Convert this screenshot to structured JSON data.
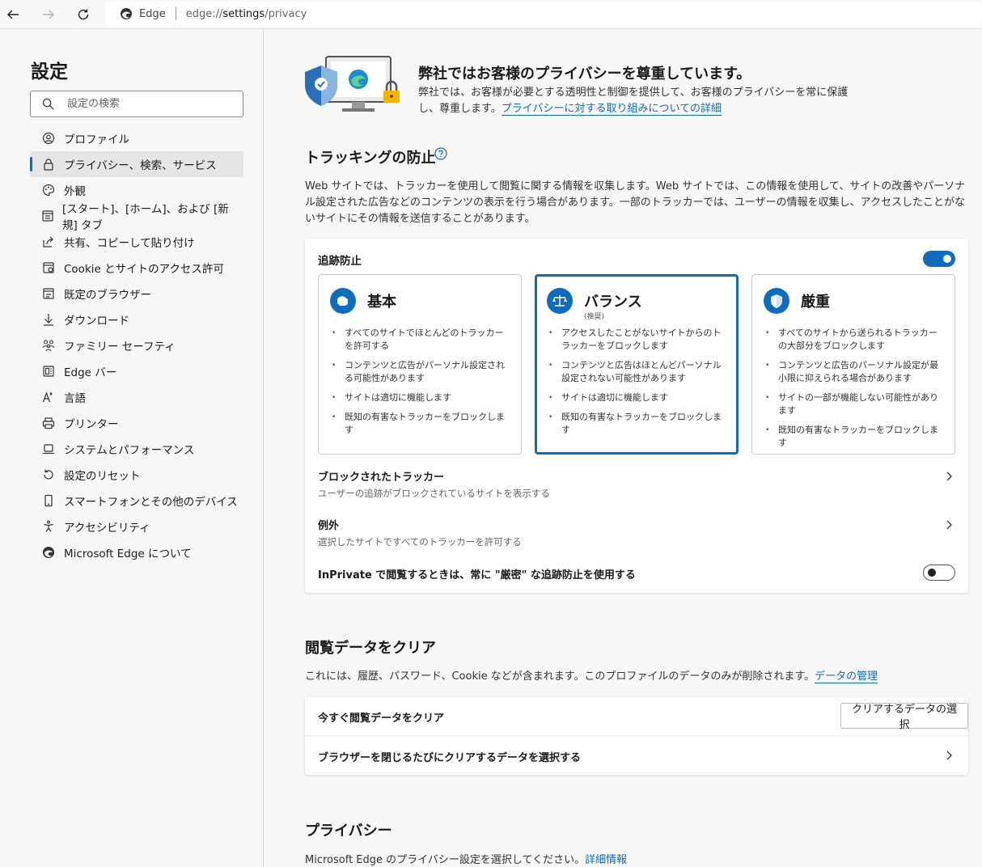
{
  "browser": {
    "brand": "Edge",
    "url_prefix": "edge://",
    "url_host": "settings",
    "url_path": "/privacy"
  },
  "sidebar": {
    "title": "設定",
    "search_placeholder": "設定の検索",
    "items": [
      {
        "label": "プロファイル",
        "icon": "profile-icon"
      },
      {
        "label": "プライバシー、検索、サービス",
        "icon": "lock-icon",
        "active": true
      },
      {
        "label": "外観",
        "icon": "palette-icon"
      },
      {
        "label": "[スタート]、[ホーム]、および [新規] タブ",
        "icon": "home-tabs-icon"
      },
      {
        "label": "共有、コピーして貼り付け",
        "icon": "share-icon"
      },
      {
        "label": "Cookie とサイトのアクセス許可",
        "icon": "cookie-permissions-icon"
      },
      {
        "label": "既定のブラウザー",
        "icon": "default-browser-icon"
      },
      {
        "label": "ダウンロード",
        "icon": "download-icon"
      },
      {
        "label": "ファミリー セーフティ",
        "icon": "family-icon"
      },
      {
        "label": "Edge バー",
        "icon": "edge-bar-icon"
      },
      {
        "label": "言語",
        "icon": "language-icon"
      },
      {
        "label": "プリンター",
        "icon": "printer-icon"
      },
      {
        "label": "システムとパフォーマンス",
        "icon": "laptop-icon"
      },
      {
        "label": "設定のリセット",
        "icon": "reset-icon"
      },
      {
        "label": "スマートフォンとその他のデバイス",
        "icon": "phone-icon"
      },
      {
        "label": "アクセシビリティ",
        "icon": "accessibility-icon"
      },
      {
        "label": "Microsoft Edge について",
        "icon": "edge-logo-icon"
      }
    ]
  },
  "hero": {
    "title": "弊社ではお客様のプライバシーを尊重しています。",
    "desc": "弊社では、お客様が必要とする透明性と制御を提供して、お客様のプライバシーを常に保護し、尊重します。",
    "link": "プライバシーに対する取り組みについての詳細"
  },
  "tracking": {
    "title": "トラッキングの防止",
    "desc": "Web サイトでは、トラッカーを使用して閲覧に関する情報を収集します。Web サイトでは、この情報を使用して、サイトの改善やパーソナル設定された広告などのコンテンツの表示を行う場合があります。一部のトラッカーでは、ユーザーの情報を収集し、アクセスしたことがないサイトにその情報を送信することがあります。",
    "toggle_label": "追跡防止",
    "toggle_on": true,
    "options": [
      {
        "title": "基本",
        "subtitle": "",
        "bullets": [
          "すべてのサイトでほとんどのトラッカーを許可する",
          "コンテンツと広告がパーソナル設定される可能性があります",
          "サイトは適切に機能します",
          "既知の有害なトラッカーをブロックします"
        ]
      },
      {
        "title": "バランス",
        "subtitle": "(推奨)",
        "selected": true,
        "bullets": [
          "アクセスしたことがないサイトからのトラッカーをブロックします",
          "コンテンツと広告はほとんどパーソナル設定されない可能性があります",
          "サイトは適切に機能します",
          "既知の有害なトラッカーをブロックします"
        ]
      },
      {
        "title": "厳重",
        "subtitle": "",
        "bullets": [
          "すべてのサイトから送られるトラッカーの大部分をブロックします",
          "コンテンツと広告のパーソナル設定が最小限に抑えられる場合があります",
          "サイトの一部が機能しない可能性があります",
          "既知の有害なトラッカーをブロックします"
        ]
      }
    ],
    "blocked_title": "ブロックされたトラッカー",
    "blocked_sub": "ユーザーの追跡がブロックされているサイトを表示する",
    "exceptions_title": "例外",
    "exceptions_sub": "選択したサイトですべてのトラッカーを許可する",
    "inprivate_label": "InPrivate で閲覧するときは、常に \"厳密\" な追跡防止を使用する",
    "inprivate_on": false
  },
  "clear": {
    "title": "閲覧データをクリア",
    "desc": "これには、履歴、パスワード、Cookie などが含まれます。このプロファイルのデータのみが削除されます。",
    "link": "データの管理",
    "now_label": "今すぐ閲覧データをクリア",
    "now_button": "クリアするデータの選択",
    "on_close_label": "ブラウザーを閉じるたびにクリアするデータを選択する"
  },
  "privacy": {
    "title": "プライバシー",
    "desc": "Microsoft Edge のプライバシー設定を選択してください。",
    "link": "詳細情報"
  },
  "colors": {
    "accent": "#0f6cbd"
  }
}
